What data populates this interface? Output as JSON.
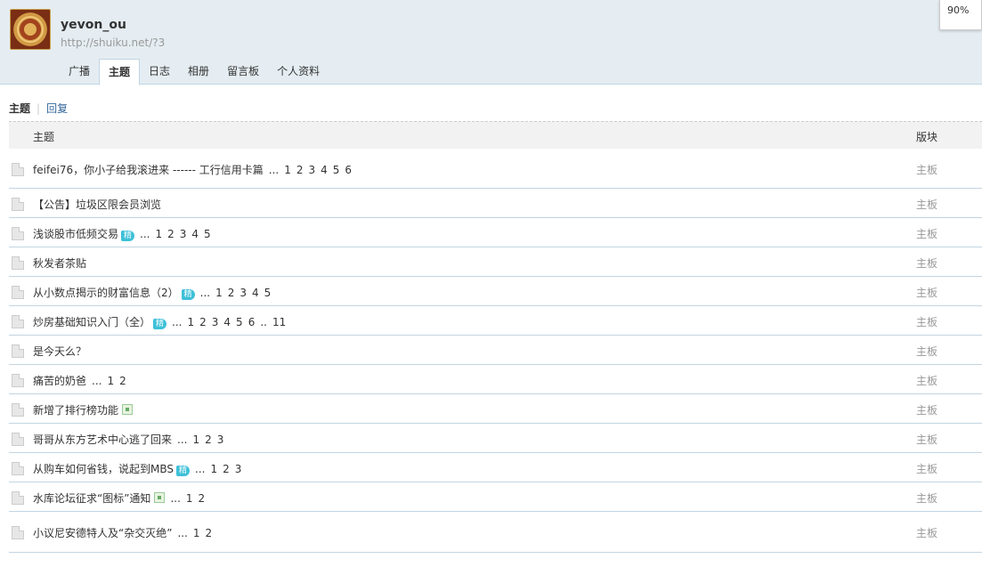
{
  "profile": {
    "username": "yevon_ou",
    "url": "http://shuiku.net/?3",
    "avatar_icon": "dragon-emblem-icon"
  },
  "zoom": "90%",
  "tabs": [
    {
      "label": "广播",
      "active": false
    },
    {
      "label": "主题",
      "active": true
    },
    {
      "label": "日志",
      "active": false
    },
    {
      "label": "相册",
      "active": false
    },
    {
      "label": "留言板",
      "active": false
    },
    {
      "label": "个人资料",
      "active": false
    }
  ],
  "subnav": {
    "current": "主题",
    "separator": "|",
    "other": "回复"
  },
  "table": {
    "headers": {
      "subject": "主题",
      "forum": "版块"
    },
    "rows": [
      {
        "title": "feifei76，你小子给我滚进来 ------ 工行信用卡篇",
        "badge": "",
        "img": false,
        "pages": [
          "1",
          "2",
          "3",
          "4",
          "5",
          "6"
        ],
        "forum": "主板"
      },
      {
        "title": "【公告】垃圾区限会员浏览",
        "badge": "",
        "img": false,
        "pages": [],
        "forum": "主板"
      },
      {
        "title": "浅谈股市低频交易",
        "badge": "精",
        "img": false,
        "pages": [
          "1",
          "2",
          "3",
          "4",
          "5"
        ],
        "forum": "主板"
      },
      {
        "title": "秋发者茶贴",
        "badge": "",
        "img": false,
        "pages": [],
        "forum": "主板"
      },
      {
        "title": "从小数点揭示的财富信息（2）",
        "badge": "精",
        "img": false,
        "pages": [
          "1",
          "2",
          "3",
          "4",
          "5"
        ],
        "forum": "主板"
      },
      {
        "title": "炒房基础知识入门（全）",
        "badge": "精",
        "img": false,
        "pages": [
          "1",
          "2",
          "3",
          "4",
          "5",
          "6",
          "..",
          "11"
        ],
        "forum": "主板"
      },
      {
        "title": "是今天么？",
        "badge": "",
        "img": false,
        "pages": [],
        "forum": "主板"
      },
      {
        "title": "痛苦的奶爸",
        "badge": "",
        "img": false,
        "pages": [
          "1",
          "2"
        ],
        "forum": "主板"
      },
      {
        "title": "新增了排行榜功能",
        "badge": "",
        "img": true,
        "pages": [],
        "forum": "主板"
      },
      {
        "title": "哥哥从东方艺术中心逃了回来",
        "badge": "",
        "img": false,
        "pages": [
          "1",
          "2",
          "3"
        ],
        "forum": "主板"
      },
      {
        "title": "从购车如何省钱，说起到MBS",
        "badge": "精",
        "img": false,
        "pages": [
          "1",
          "2",
          "3"
        ],
        "forum": "主板"
      },
      {
        "title": "水库论坛征求“图标”通知",
        "badge": "",
        "img": true,
        "pages": [
          "1",
          "2"
        ],
        "forum": "主板"
      },
      {
        "title": "小议尼安德特人及“杂交灭绝”",
        "badge": "",
        "img": false,
        "pages": [
          "1",
          "2"
        ],
        "forum": "主板"
      }
    ]
  }
}
